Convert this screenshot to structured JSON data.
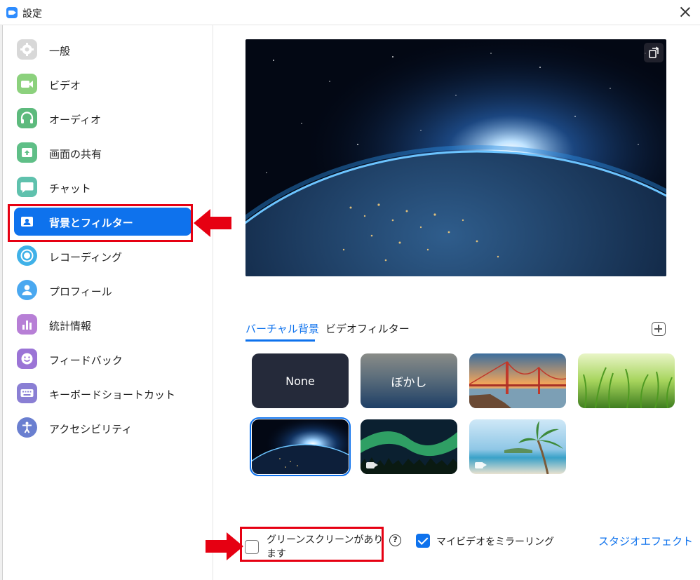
{
  "window": {
    "title": "設定"
  },
  "sidebar": {
    "items": [
      {
        "label": "一般",
        "icon": "gear-icon",
        "color": "#d3d3d3"
      },
      {
        "label": "ビデオ",
        "icon": "video-camera-icon",
        "color": "#8cd17d"
      },
      {
        "label": "オーディオ",
        "icon": "headphones-icon",
        "color": "#5dba7d"
      },
      {
        "label": "画面の共有",
        "icon": "share-screen-icon",
        "color": "#5fbf87"
      },
      {
        "label": "チャット",
        "icon": "chat-bubble-icon",
        "color": "#5fc1ad"
      },
      {
        "label": "背景とフィルター",
        "icon": "background-portrait-icon",
        "color": "#0e72ed",
        "active": true
      },
      {
        "label": "レコーディング",
        "icon": "record-icon",
        "color": "#3fb1e8"
      },
      {
        "label": "プロフィール",
        "icon": "profile-icon",
        "color": "#4aa8f0"
      },
      {
        "label": "統計情報",
        "icon": "statistics-icon",
        "color": "#b77fd6"
      },
      {
        "label": "フィードバック",
        "icon": "feedback-smile-icon",
        "color": "#9b74d6"
      },
      {
        "label": "キーボードショートカット",
        "icon": "keyboard-icon",
        "color": "#8a7fd4"
      },
      {
        "label": "アクセシビリティ",
        "icon": "accessibility-icon",
        "color": "#6a7fd0"
      }
    ]
  },
  "tabs": {
    "virtual_background": "バーチャル背景",
    "video_filter": "ビデオフィルター"
  },
  "backgrounds": [
    {
      "label": "None",
      "kind": "none"
    },
    {
      "label": "ぼかし",
      "kind": "blur"
    },
    {
      "label": "",
      "kind": "golden-gate"
    },
    {
      "label": "",
      "kind": "grass"
    },
    {
      "label": "",
      "kind": "earth",
      "selected": true
    },
    {
      "label": "",
      "kind": "aurora",
      "video": true
    },
    {
      "label": "",
      "kind": "beach",
      "video": true
    }
  ],
  "options": {
    "green_screen_label": "グリーンスクリーンがあります",
    "green_screen_checked": false,
    "help_glyph": "?",
    "mirror_label": "マイビデオをミラーリング",
    "mirror_checked": true,
    "studio_effects_label": "スタジオエフェクト"
  },
  "colors": {
    "accent": "#0e72ed",
    "annotation_red": "#e60012"
  }
}
